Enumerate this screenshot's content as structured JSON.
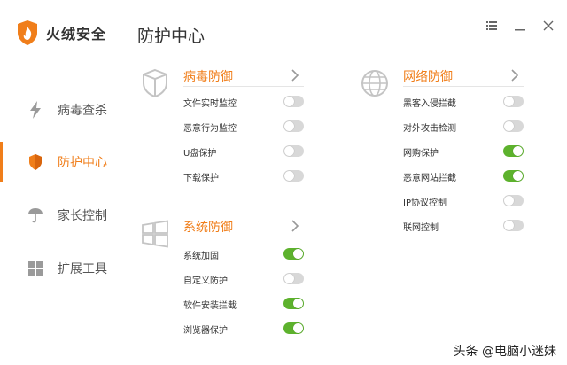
{
  "app": {
    "name": "火绒安全",
    "brand_color": "#f07e1a"
  },
  "header": {
    "title": "防护中心"
  },
  "window_controls": [
    {
      "name": "menu-icon",
      "symbol": "☰"
    },
    {
      "name": "minimize-icon",
      "symbol": "—"
    },
    {
      "name": "close-icon",
      "symbol": "✕"
    }
  ],
  "sidebar": {
    "items": [
      {
        "label": "病毒查杀",
        "icon": "lightning-icon",
        "active": false
      },
      {
        "label": "防护中心",
        "icon": "shield-icon",
        "active": true
      },
      {
        "label": "家长控制",
        "icon": "umbrella-icon",
        "active": false
      },
      {
        "label": "扩展工具",
        "icon": "grid-icon",
        "active": false
      }
    ]
  },
  "sections": {
    "virus": {
      "title": "病毒防御",
      "icon": "shield-outline-icon",
      "items": [
        {
          "label": "文件实时监控",
          "on": false
        },
        {
          "label": "恶意行为监控",
          "on": false
        },
        {
          "label": "U盘保护",
          "on": false
        },
        {
          "label": "下载保护",
          "on": false
        }
      ]
    },
    "network": {
      "title": "网络防御",
      "icon": "globe-icon",
      "items": [
        {
          "label": "黑客入侵拦截",
          "on": false
        },
        {
          "label": "对外攻击检测",
          "on": false
        },
        {
          "label": "网购保护",
          "on": true
        },
        {
          "label": "恶意网站拦截",
          "on": true
        },
        {
          "label": "IP协议控制",
          "on": false
        },
        {
          "label": "联网控制",
          "on": false
        }
      ]
    },
    "system": {
      "title": "系统防御",
      "icon": "windows-icon",
      "items": [
        {
          "label": "系统加固",
          "on": true
        },
        {
          "label": "自定义防护",
          "on": false
        },
        {
          "label": "软件安装拦截",
          "on": true
        },
        {
          "label": "浏览器保护",
          "on": true
        }
      ]
    }
  },
  "colors": {
    "toggle_on": "#5db22d",
    "toggle_off": "#d8d8d8",
    "accent": "#f07e1a"
  },
  "watermark": "头条 @电脑小迷妹"
}
